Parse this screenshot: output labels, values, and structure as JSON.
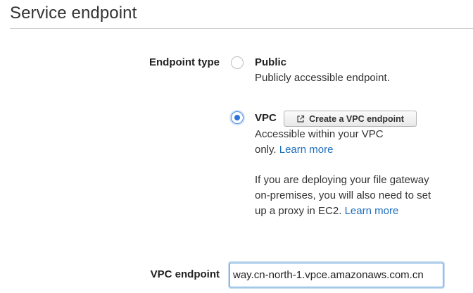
{
  "section": {
    "title": "Service endpoint"
  },
  "endpoint_type": {
    "label": "Endpoint type",
    "options": [
      {
        "title": "Public",
        "selected": false,
        "description": "Publicly accessible endpoint."
      },
      {
        "title": "VPC",
        "selected": true,
        "button_label": "Create a VPC endpoint",
        "button_icon": "external-link-icon",
        "description_line1": "Accessible within your VPC",
        "description_line2_text": "only.",
        "description_line2_link": "Learn more",
        "note_line1": "If you are deploying your file gateway",
        "note_line2": "on-premises, you will also need to set",
        "note_line3_text": "up a proxy in EC2.",
        "note_line3_link": "Learn more"
      }
    ]
  },
  "vpc_endpoint": {
    "label": "VPC endpoint",
    "value": "way.cn-north-1.vpce.amazonaws.com.cn"
  },
  "colors": {
    "link": "#1f6fbd",
    "radio_selected": "#2f73d9",
    "focus_border": "#5b9bd5"
  }
}
